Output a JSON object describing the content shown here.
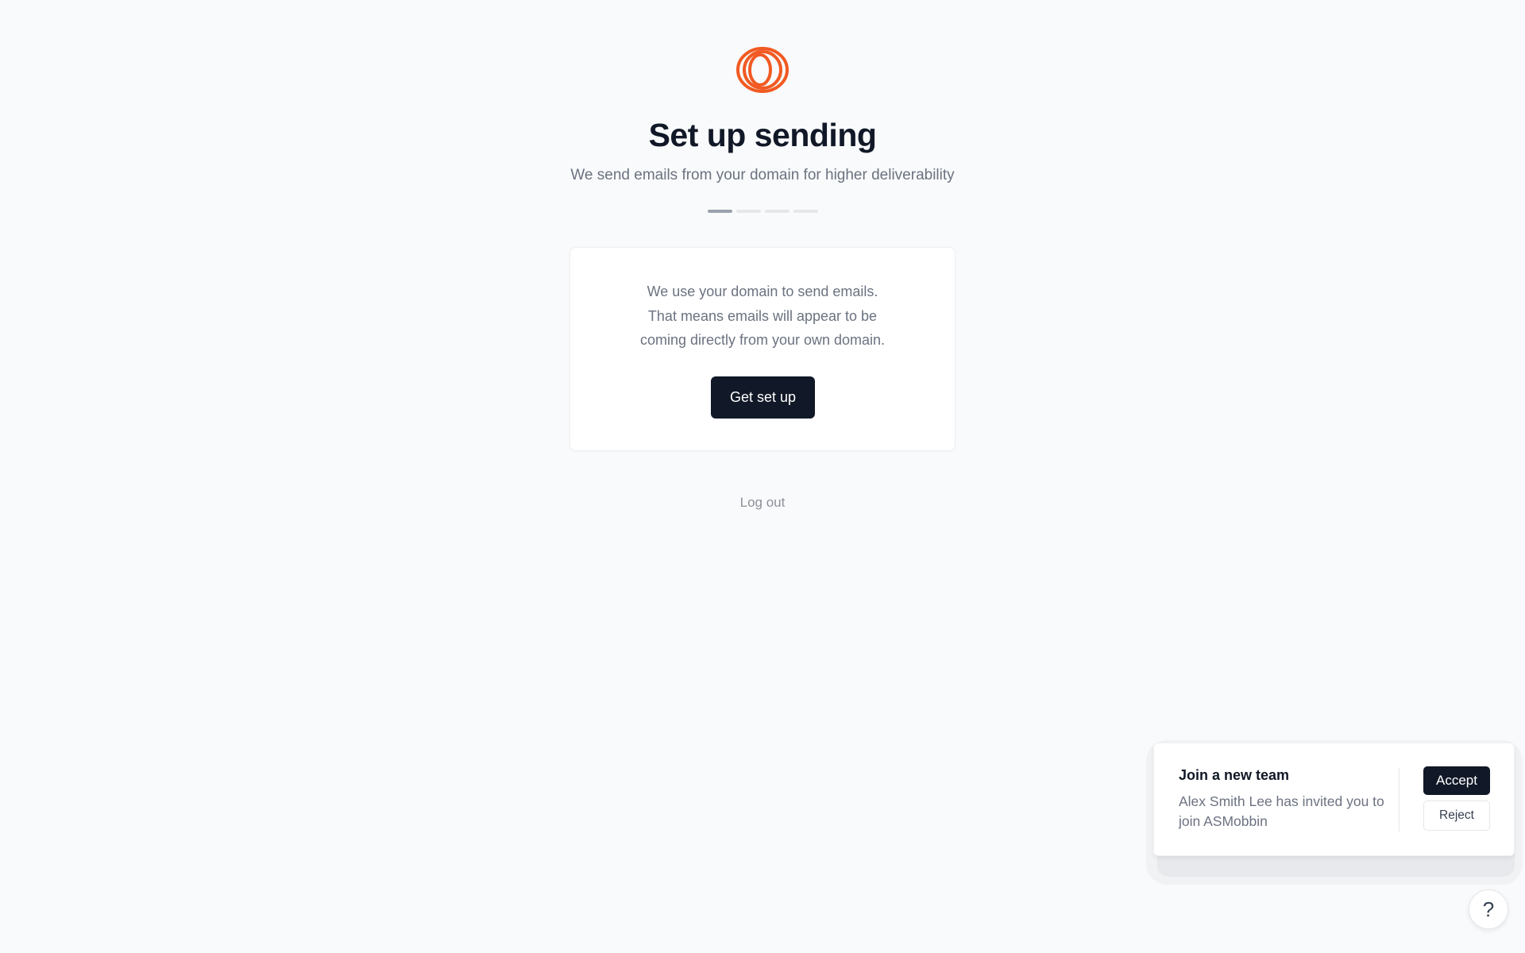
{
  "brand": {
    "logo_icon": "orange-rings-logo-icon",
    "accent_color": "#f15a22"
  },
  "header": {
    "title": "Set up sending",
    "subtitle": "We send emails from your domain for higher deliverability"
  },
  "progress": {
    "total_steps": 4,
    "current_step": 1
  },
  "card": {
    "lines": [
      "We use your domain to send emails.",
      "That means emails will appear to be",
      "coming directly from your own domain."
    ],
    "button_label": "Get set up"
  },
  "logout_label": "Log out",
  "invite_toast": {
    "title": "Join a new team",
    "body": "Alex Smith Lee has invited you to join ASMobbin",
    "accept_label": "Accept",
    "reject_label": "Reject"
  },
  "help": {
    "label": "?",
    "icon": "help-icon"
  }
}
